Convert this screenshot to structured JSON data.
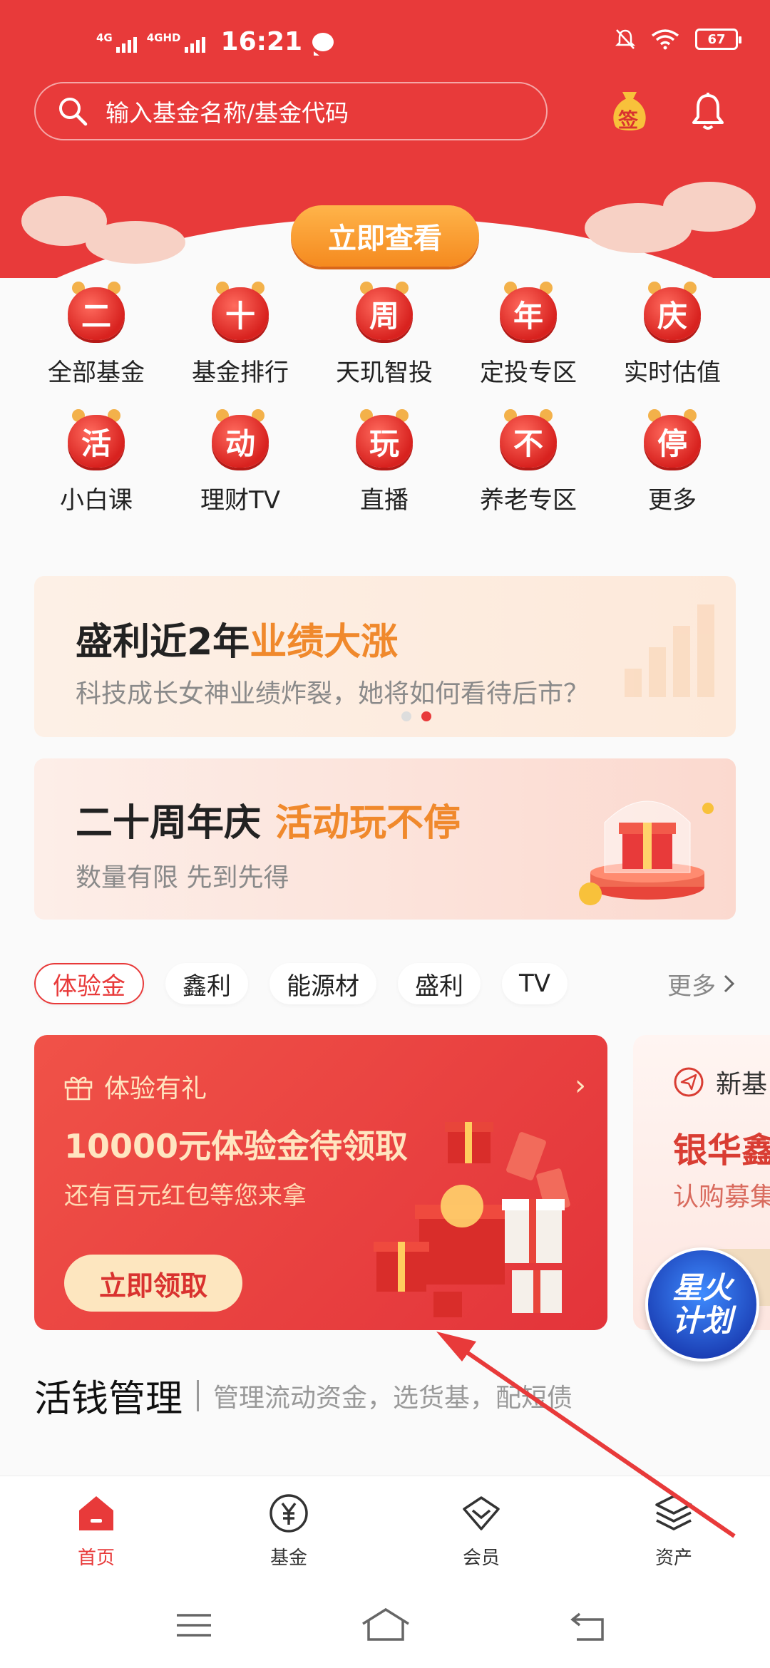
{
  "status_bar": {
    "net1": "4G",
    "net2": "4GHD",
    "time": "16:21",
    "battery": "67"
  },
  "search": {
    "placeholder": "输入基金名称/基金代码",
    "sign_label": "签"
  },
  "banner": {
    "button": "立即查看"
  },
  "grid": {
    "row1": [
      {
        "char": "二",
        "label": "全部基金"
      },
      {
        "char": "十",
        "label": "基金排行"
      },
      {
        "char": "周",
        "label": "天玑智投"
      },
      {
        "char": "年",
        "label": "定投专区"
      },
      {
        "char": "庆",
        "label": "实时估值"
      }
    ],
    "row2": [
      {
        "char": "活",
        "label": "小白课"
      },
      {
        "char": "动",
        "label": "理财TV"
      },
      {
        "char": "玩",
        "label": "直播"
      },
      {
        "char": "不",
        "label": "养老专区"
      },
      {
        "char": "停",
        "label": "更多"
      }
    ]
  },
  "promo1": {
    "title": "盛利近2年",
    "title_highlight": "业绩大涨",
    "subtitle": "科技成长女神业绩炸裂，她将如何看待后市？"
  },
  "promo2": {
    "title": "二十周年庆",
    "title_highlight": "活动玩不停",
    "subtitle": "数量有限  先到先得"
  },
  "tags": {
    "items": [
      "体验金",
      "鑫利",
      "能源材",
      "盛利",
      "TV"
    ],
    "more": "更多"
  },
  "experience_card": {
    "header": "体验有礼",
    "headline": "10000元体验金待领取",
    "sub": "还有百元红包等您来拿",
    "button": "立即领取"
  },
  "next_card": {
    "header": "新基",
    "headline": "银华鑫",
    "sub": "认购募集"
  },
  "spark_badge": {
    "line1": "星火",
    "line2": "计划"
  },
  "section": {
    "title": "活钱管理",
    "subtitle": "管理流动资金，选货基，配短债"
  },
  "bottom_nav": {
    "items": [
      "首页",
      "基金",
      "会员",
      "资产"
    ]
  },
  "colors": {
    "brand_red": "#e83a3a",
    "accent_orange": "#f0892c"
  }
}
